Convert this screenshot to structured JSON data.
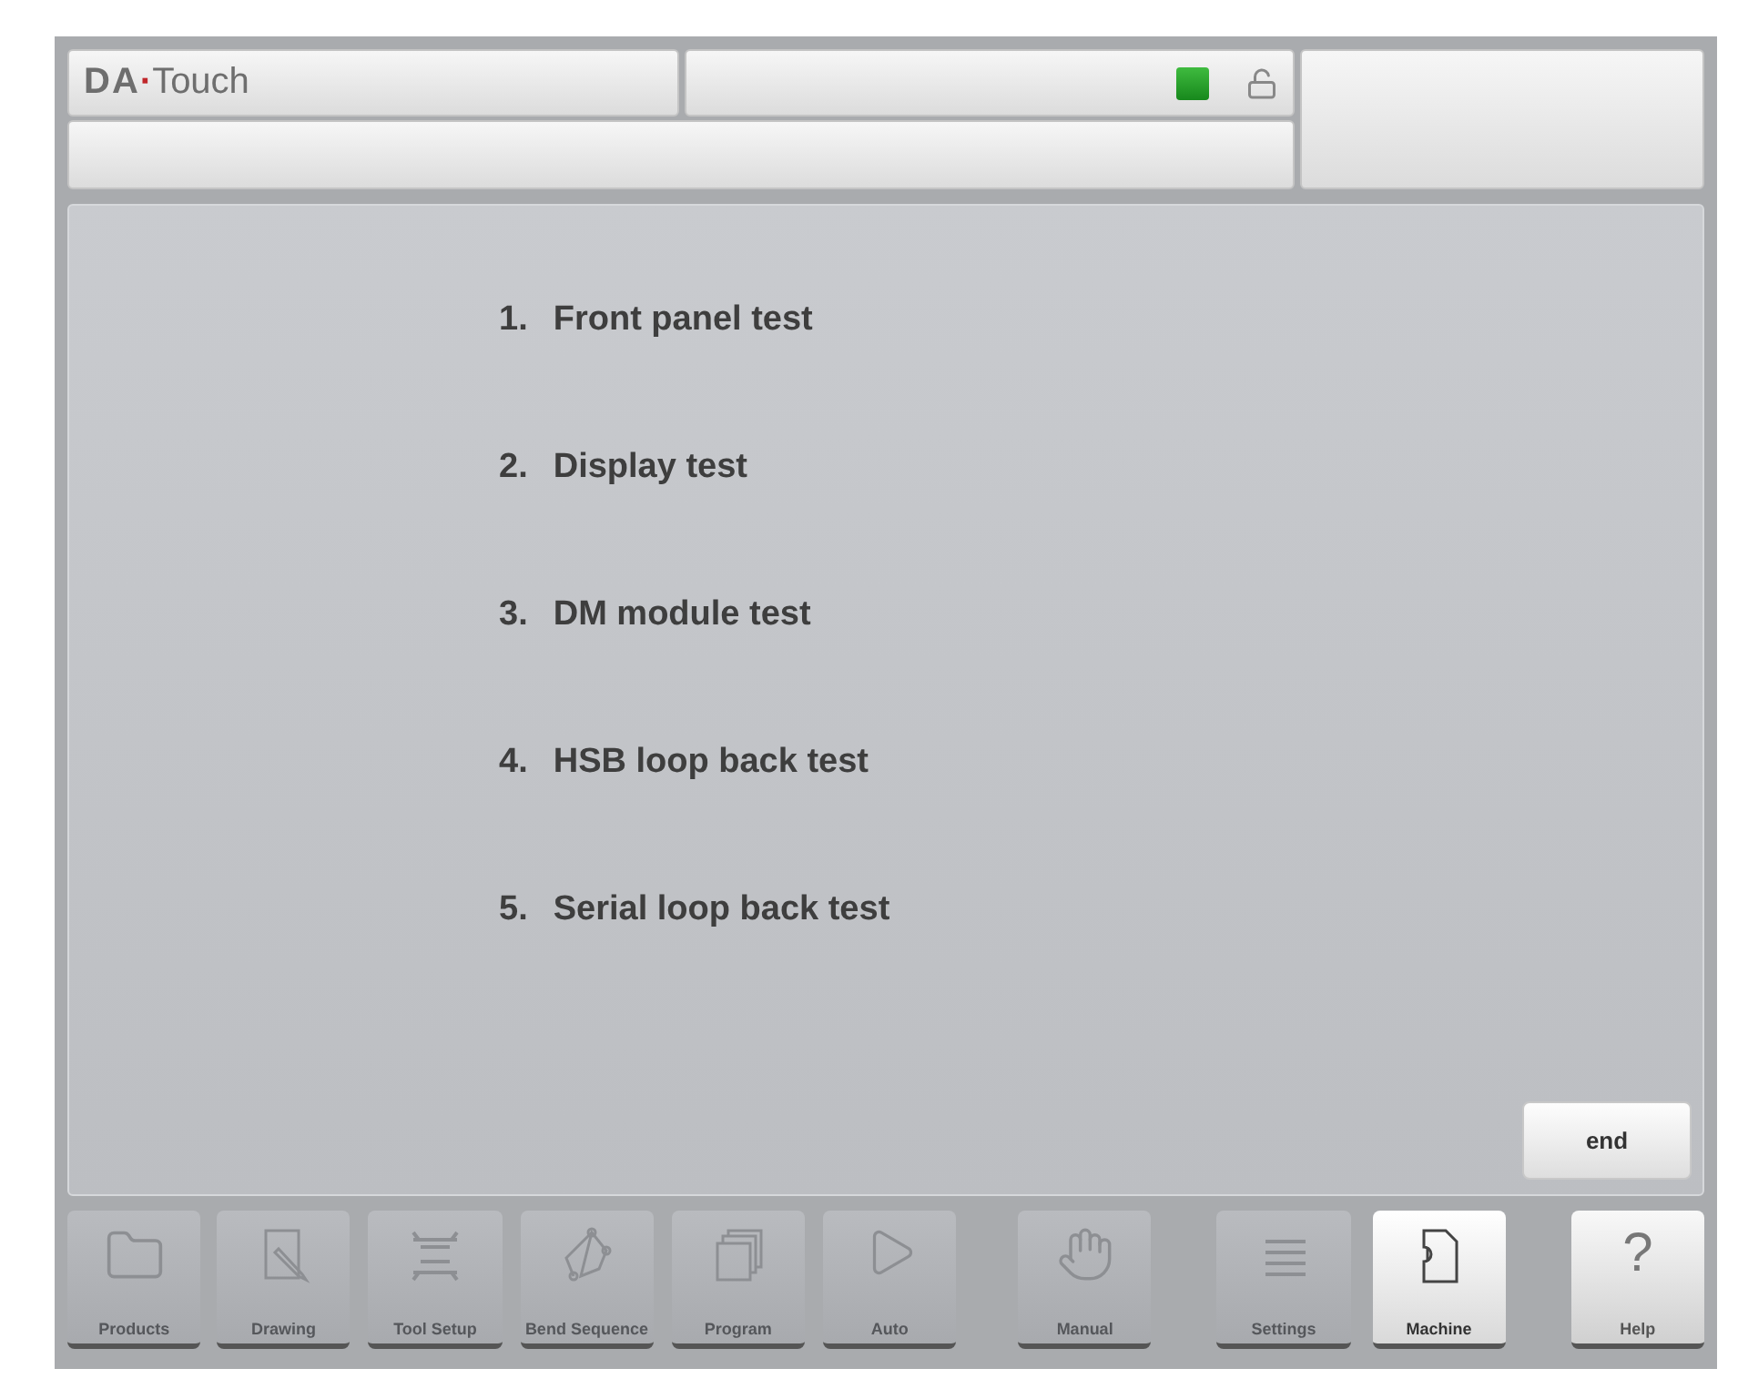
{
  "header": {
    "logo": {
      "strong": "DA",
      "dot": "·",
      "rest": "Touch"
    },
    "indicator": {
      "on": true
    },
    "lock": {
      "locked": false
    }
  },
  "tests": [
    {
      "number": "1.",
      "label": "Front panel test"
    },
    {
      "number": "2.",
      "label": "Display test"
    },
    {
      "number": "3.",
      "label": "DM module test"
    },
    {
      "number": "4.",
      "label": "HSB loop back test"
    },
    {
      "number": "5.",
      "label": "Serial loop back test"
    }
  ],
  "end_button": "end",
  "nav": [
    {
      "label": "Products",
      "kind": "folder",
      "disabled": true,
      "selected": false
    },
    {
      "label": "Drawing",
      "kind": "drawing",
      "disabled": true,
      "selected": false
    },
    {
      "label": "Tool Setup",
      "kind": "tools",
      "disabled": true,
      "selected": false
    },
    {
      "label": "Bend Sequence",
      "kind": "bend",
      "disabled": true,
      "selected": false
    },
    {
      "label": "Program",
      "kind": "program",
      "disabled": true,
      "selected": false
    },
    {
      "label": "Auto",
      "kind": "play",
      "disabled": true,
      "selected": false
    },
    {
      "label": "Manual",
      "kind": "hand",
      "disabled": true,
      "selected": false
    },
    {
      "label": "Settings",
      "kind": "list",
      "disabled": true,
      "selected": false
    },
    {
      "label": "Machine",
      "kind": "machine",
      "disabled": false,
      "selected": true
    },
    {
      "label": "Help",
      "kind": "help",
      "glyph": "?",
      "disabled": false,
      "selected": false
    }
  ]
}
